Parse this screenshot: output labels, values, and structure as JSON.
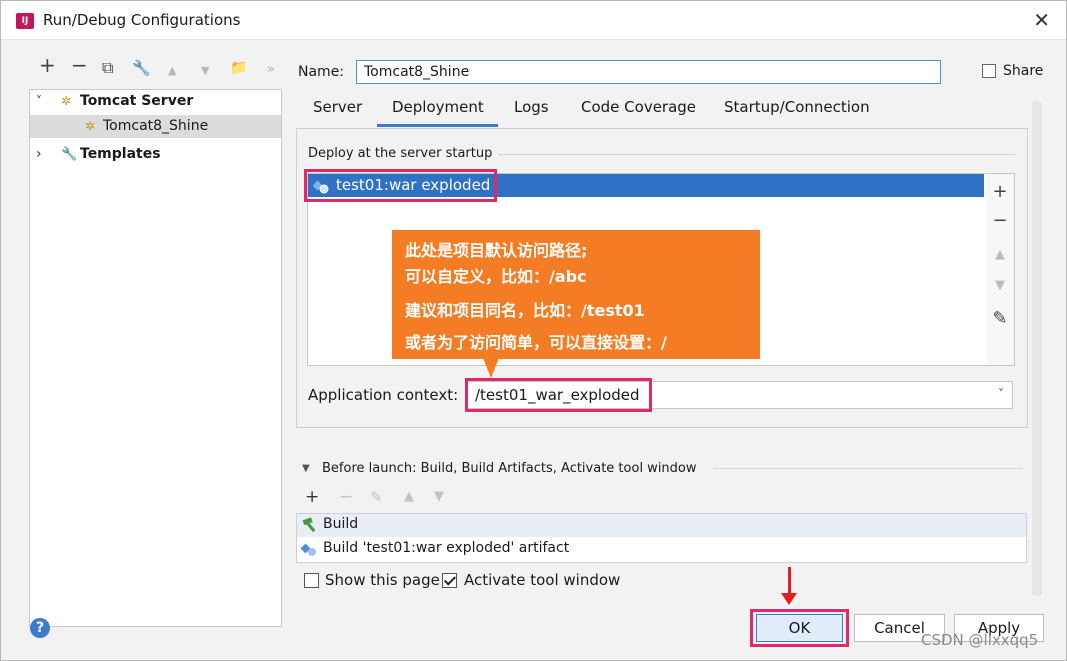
{
  "window": {
    "title": "Run/Debug Configurations",
    "close_glyph": "✕"
  },
  "toolbar": {
    "add": "+",
    "remove": "−",
    "copy": "⧉",
    "edit": "🔧",
    "up": "▲",
    "down": "▼",
    "folder": "📁",
    "more": "»"
  },
  "tree": {
    "items": [
      {
        "label": "Tomcat Server",
        "arrow": "˅",
        "icon": "tomcat-icon"
      },
      {
        "label": "Tomcat8_Shine",
        "icon": "tomcat-icon"
      },
      {
        "label": "Templates",
        "arrow": "›",
        "icon": "wrench-icon"
      }
    ]
  },
  "name_field": {
    "label": "Name:",
    "value": "Tomcat8_Shine"
  },
  "share": {
    "label": "Share",
    "checked": false
  },
  "tabs": [
    {
      "label": "Server"
    },
    {
      "label": "Deployment",
      "active": true
    },
    {
      "label": "Logs"
    },
    {
      "label": "Code Coverage"
    },
    {
      "label": "Startup/Connection"
    }
  ],
  "deploy": {
    "group_title": "Deploy at the server startup",
    "items": [
      {
        "label": "test01:war exploded",
        "selected": true
      }
    ],
    "side_buttons": [
      "+",
      "−",
      "▲",
      "▼",
      "✎"
    ]
  },
  "callout": {
    "lines": [
      "此处是项目默认访问路径;",
      "可以自定义，比如：/abc",
      "建议和项目同名，比如：/test01",
      "或者为了访问简单，可以直接设置：/"
    ]
  },
  "app_context": {
    "label": "Application context:",
    "value": "/test01_war_exploded",
    "chevron": "˅"
  },
  "before_launch": {
    "collapse": "▼",
    "title": "Before launch: Build, Build Artifacts, Activate tool window",
    "toolbar": [
      "+",
      "−",
      "✎",
      "▲",
      "▼"
    ],
    "items": [
      {
        "label": "Build",
        "icon": "hammer-icon"
      },
      {
        "label": "Build 'test01:war exploded' artifact",
        "icon": "artifact-icon"
      }
    ]
  },
  "options": {
    "show_page": {
      "label": "Show this page",
      "checked": false
    },
    "activate_tool": {
      "label": "Activate tool window",
      "checked": true
    }
  },
  "buttons": {
    "help": "?",
    "ok": "OK",
    "cancel": "Cancel",
    "apply": "Apply"
  },
  "watermark": "CSDN @llxxqq5",
  "colors": {
    "highlight": "#e0286c",
    "callout": "#f37c24",
    "selection": "#2f71c5",
    "arrow": "#e0201b"
  }
}
